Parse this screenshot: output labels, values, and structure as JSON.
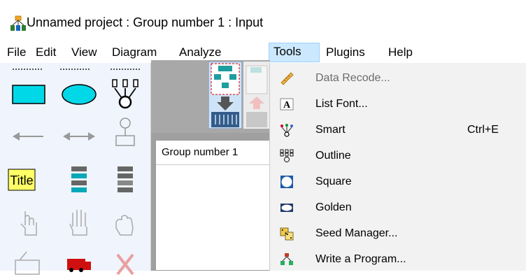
{
  "window": {
    "title": "Unnamed project : Group number 1 : Input",
    "app_icon": "network-diagram-icon"
  },
  "menubar": {
    "items": [
      {
        "label": "File"
      },
      {
        "label": "Edit"
      },
      {
        "label": "View"
      },
      {
        "label": "Diagram"
      },
      {
        "label": "Analyze"
      },
      {
        "label": "Tools",
        "active": true
      },
      {
        "label": "Plugins"
      },
      {
        "label": "Help"
      }
    ]
  },
  "palette": {
    "tools": [
      "rectangle-icon",
      "ellipse-icon",
      "indicator-icon",
      "single-arrow-icon",
      "double-arrow-icon",
      "unique-variable-icon",
      "title-icon",
      "list-variables-icon",
      "list-dataset-icon",
      "select-one-icon",
      "select-all-icon",
      "deselect-all-icon",
      "print-icon",
      "truck-icon",
      "delete-icon"
    ],
    "title_label": "Title"
  },
  "groups": {
    "header": "Group number 1"
  },
  "tools_menu": {
    "items": [
      {
        "label": "Data Recode...",
        "icon": "ruler-icon",
        "disabled": true,
        "shortcut": ""
      },
      {
        "label": "List Font...",
        "icon": "font-a-icon",
        "disabled": false,
        "shortcut": ""
      },
      {
        "label": "Smart",
        "icon": "smart-icon",
        "disabled": false,
        "shortcut": "Ctrl+E"
      },
      {
        "label": "Outline",
        "icon": "outline-icon",
        "disabled": false,
        "shortcut": ""
      },
      {
        "label": "Square",
        "icon": "square-icon",
        "disabled": false,
        "shortcut": ""
      },
      {
        "label": "Golden",
        "icon": "golden-icon",
        "disabled": false,
        "shortcut": ""
      },
      {
        "label": "Seed Manager...",
        "icon": "dice-icon",
        "disabled": false,
        "shortcut": ""
      },
      {
        "label": "Write a Program...",
        "icon": "program-icon",
        "disabled": false,
        "shortcut": ""
      }
    ]
  },
  "colors": {
    "menu_active_bg": "#cce8ff",
    "menu_active_border": "#99d1ff",
    "palette_bg": "#f0f4fc",
    "accent_cyan": "#00d8e8",
    "disabled_text": "#6d6d6d"
  }
}
